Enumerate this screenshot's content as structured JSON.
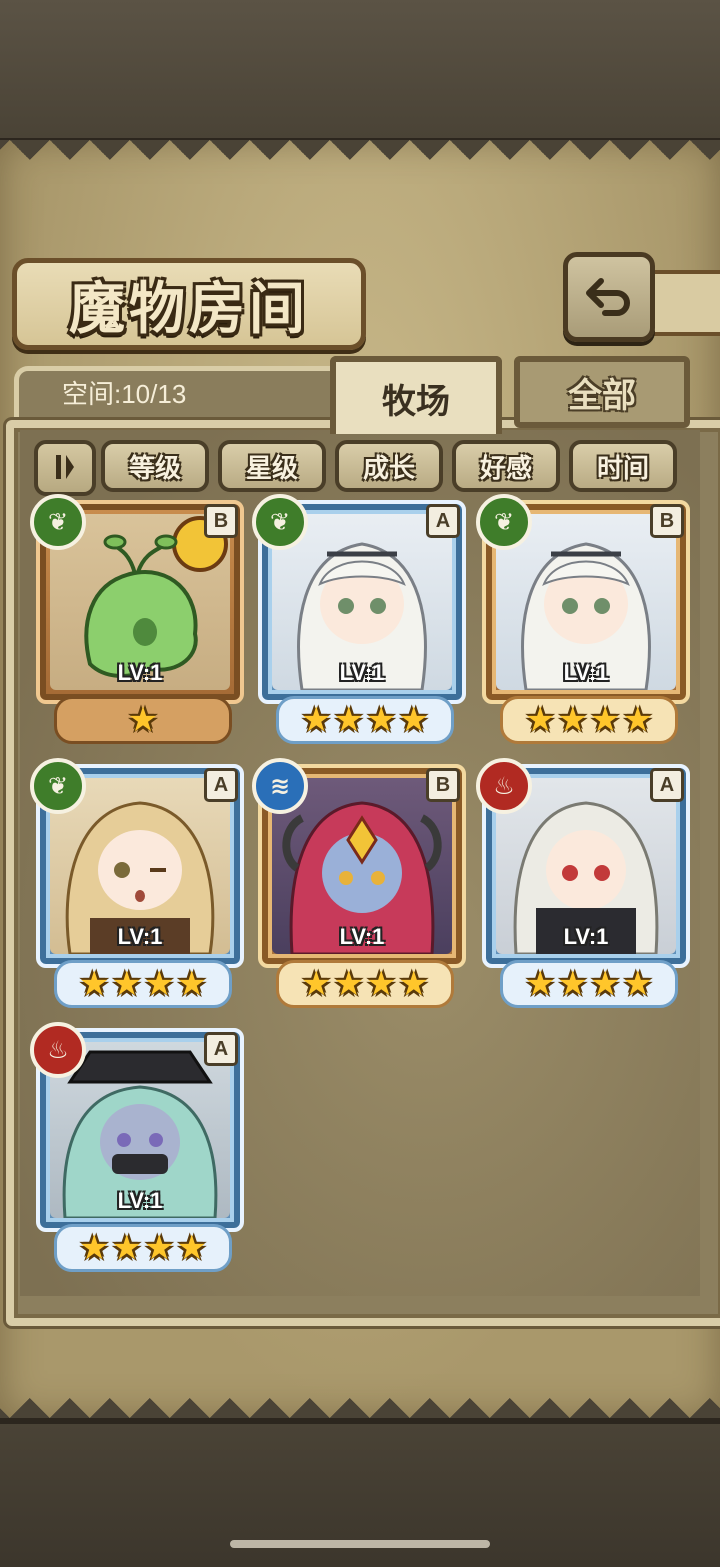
{
  "header": {
    "title": "魔物房间",
    "back_icon": "return-arrow-icon"
  },
  "storage": {
    "space_label": "空间:10/13"
  },
  "tabs": [
    {
      "label": "牧场",
      "active": true
    },
    {
      "label": "全部",
      "active": false
    }
  ],
  "sort": {
    "toggle_icon": "sort-order-icon",
    "filters": [
      "等级",
      "星级",
      "成长",
      "好感",
      "时间"
    ]
  },
  "monsters": [
    {
      "element": "nature",
      "rank": "B",
      "level": "LV:1",
      "stars": 1,
      "frame": "brown",
      "kind": "green-slime"
    },
    {
      "element": "nature",
      "rank": "A",
      "level": "LV:1",
      "stars": 4,
      "frame": "blue",
      "kind": "white-hair-girl"
    },
    {
      "element": "nature",
      "rank": "B",
      "level": "LV:1",
      "stars": 4,
      "frame": "gold",
      "kind": "white-hair-girl"
    },
    {
      "element": "nature",
      "rank": "A",
      "level": "LV:1",
      "stars": 4,
      "frame": "blue",
      "kind": "blonde-girl"
    },
    {
      "element": "water",
      "rank": "B",
      "level": "LV:1",
      "stars": 4,
      "frame": "gold",
      "kind": "red-hair-girl"
    },
    {
      "element": "fire",
      "rank": "A",
      "level": "LV:1",
      "stars": 4,
      "frame": "blue",
      "kind": "silver-hair-girl"
    },
    {
      "element": "fire",
      "rank": "A",
      "level": "LV:1",
      "stars": 4,
      "frame": "blue",
      "kind": "pirate-girl"
    }
  ],
  "colors": {
    "nature": "#3f7d2a",
    "water": "#2a6fb8",
    "fire": "#b12a22",
    "star": "#ffc62b"
  }
}
